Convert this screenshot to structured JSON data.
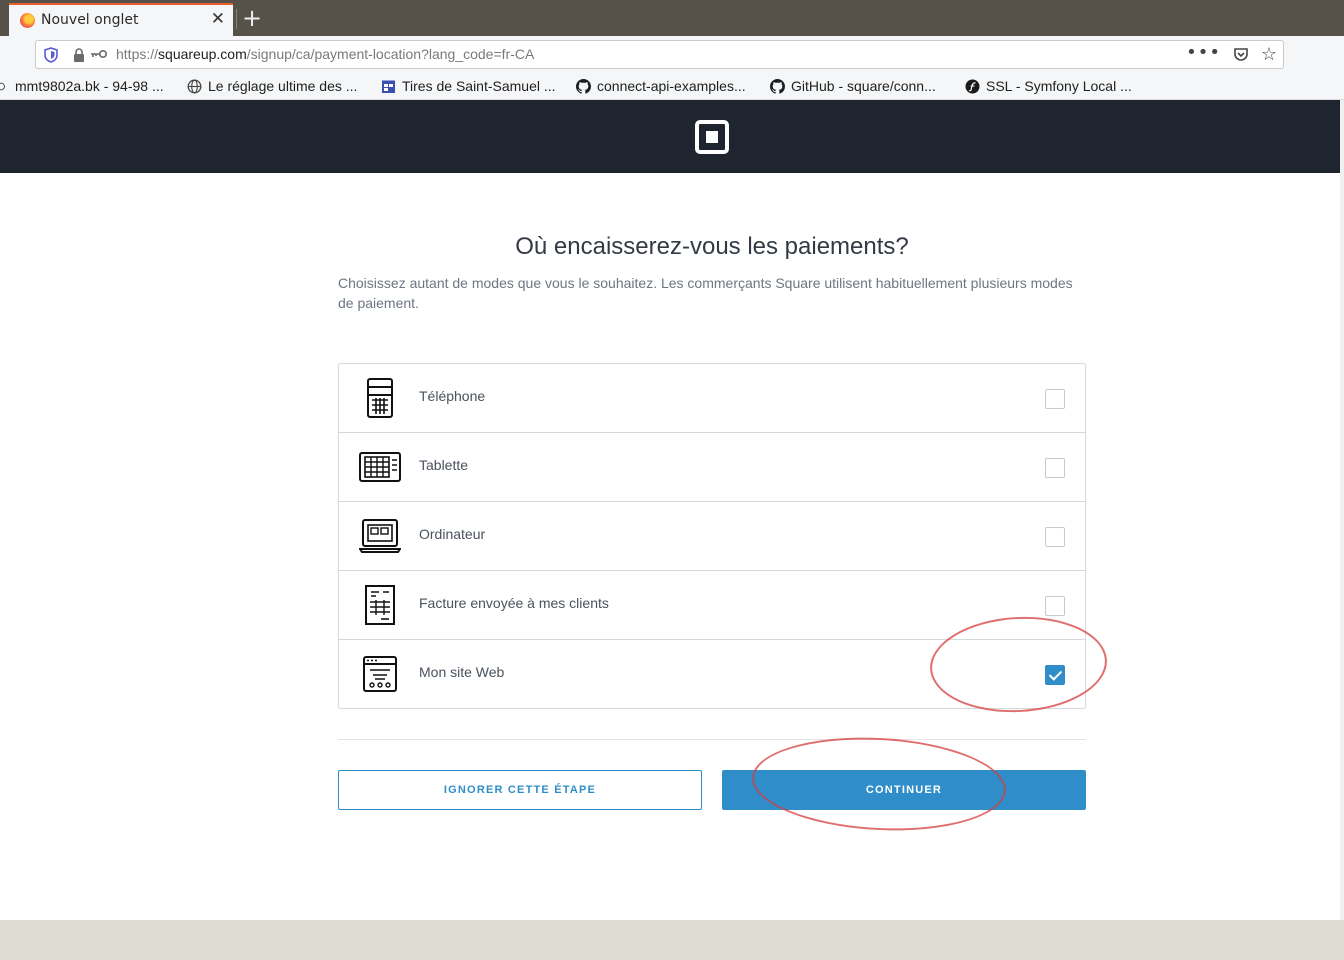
{
  "browser": {
    "tab_title": "Nouvel onglet",
    "url_prefix": "https://",
    "url_host": "squareup.com",
    "url_path": "/signup/ca/payment-location?lang_code=fr-CA",
    "bookmarks": [
      {
        "label": "mmt9802a.bk - 94-98 ...",
        "icon": "circle-icon"
      },
      {
        "label": "Le réglage ultime des ...",
        "icon": "globe-icon"
      },
      {
        "label": "Tires de Saint-Samuel ...",
        "icon": "calendar-icon"
      },
      {
        "label": "connect-api-examples...",
        "icon": "github-icon"
      },
      {
        "label": "GitHub - square/conn...",
        "icon": "github-icon"
      },
      {
        "label": "SSL - Symfony Local ...",
        "icon": "symfony-icon"
      }
    ]
  },
  "page": {
    "heading": "Où encaisserez-vous les paiements?",
    "subtext": "Choisissez autant de modes que vous le souhaitez. Les commerçants Square utilisent habituellement plusieurs modes de paiement.",
    "options": [
      {
        "label": "Téléphone",
        "icon": "phone-icon",
        "checked": false
      },
      {
        "label": "Tablette",
        "icon": "tablet-icon",
        "checked": false
      },
      {
        "label": "Ordinateur",
        "icon": "computer-icon",
        "checked": false
      },
      {
        "label": "Facture envoyée à mes clients",
        "icon": "invoice-icon",
        "checked": false
      },
      {
        "label": "Mon site Web",
        "icon": "website-icon",
        "checked": true
      }
    ],
    "skip_button": "IGNORER CETTE ÉTAPE",
    "continue_button": "CONTINUER"
  },
  "colors": {
    "accent": "#2f8ec9",
    "header_bg": "#1f252e",
    "annotation": "#d63e3e"
  }
}
